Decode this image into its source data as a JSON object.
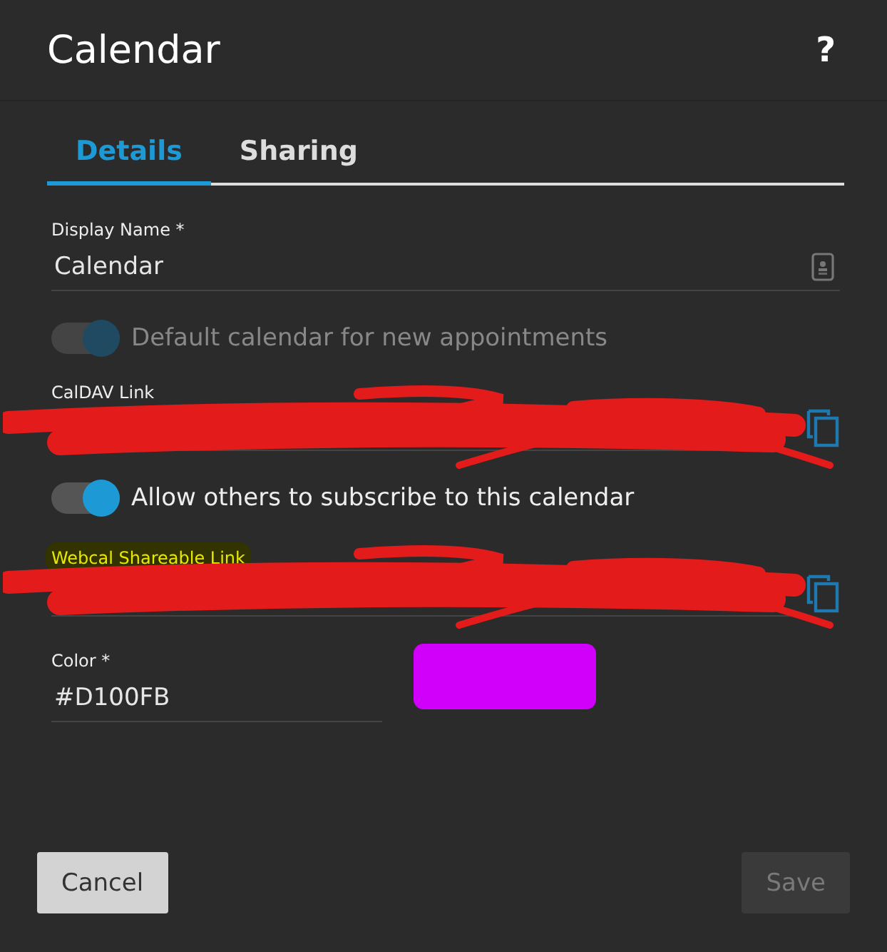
{
  "dialog": {
    "title": "Calendar",
    "help": "?"
  },
  "tabs": [
    {
      "label": "Details",
      "selected": true
    },
    {
      "label": "Sharing",
      "selected": false
    }
  ],
  "display_name": {
    "label": "Display Name *",
    "value": "Calendar"
  },
  "fields": [
    {
      "kind": "toggle",
      "label": "Default calendar for new appointments",
      "on": true,
      "disabled": true
    },
    {
      "kind": "link",
      "label": "CalDAV Link",
      "highlighted": false,
      "redacted": true
    },
    {
      "kind": "toggle",
      "label": "Allow others to subscribe to this calendar",
      "on": true,
      "disabled": false
    },
    {
      "kind": "link",
      "label": "Webcal Shareable Link",
      "highlighted": true,
      "redacted": true
    }
  ],
  "color": {
    "label": "Color *",
    "value": "#D100FB",
    "color": "#d100fb"
  },
  "buttons": [
    {
      "label": "Cancel",
      "disabled": false
    },
    {
      "label": "Save",
      "disabled": true
    }
  ]
}
